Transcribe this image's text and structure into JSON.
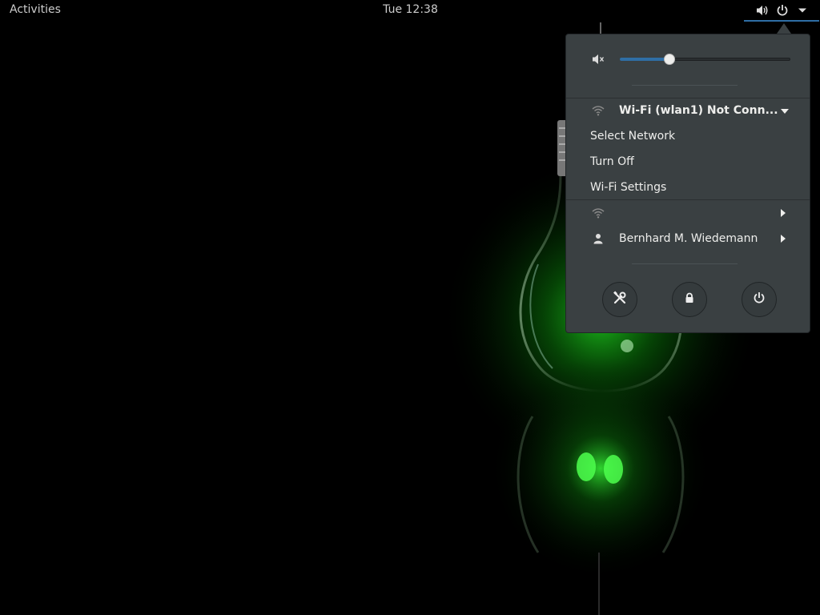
{
  "topbar": {
    "activities_label": "Activities",
    "clock": "Tue 12:38",
    "icons": [
      "volume-icon",
      "power-icon",
      "chevron-down-icon"
    ]
  },
  "system_menu": {
    "volume": {
      "icon": "volume-muted-icon",
      "level": 0.29
    },
    "wifi": {
      "icon": "wifi-icon",
      "title": "Wi-Fi (wlan1) Not Conn...",
      "items": [
        "Select Network",
        "Turn Off",
        "Wi-Fi Settings"
      ]
    },
    "network_row": {
      "icon": "wifi-icon",
      "label": ""
    },
    "user_row": {
      "icon": "user-icon",
      "label": "Bernhard M. Wiedemann"
    },
    "action_buttons": [
      "settings-icon",
      "lock-icon",
      "power-icon"
    ]
  },
  "colors": {
    "accent": "#2f6ea5",
    "menu_bg": "#3a4042",
    "bulb_glow": "#1fd61f"
  }
}
